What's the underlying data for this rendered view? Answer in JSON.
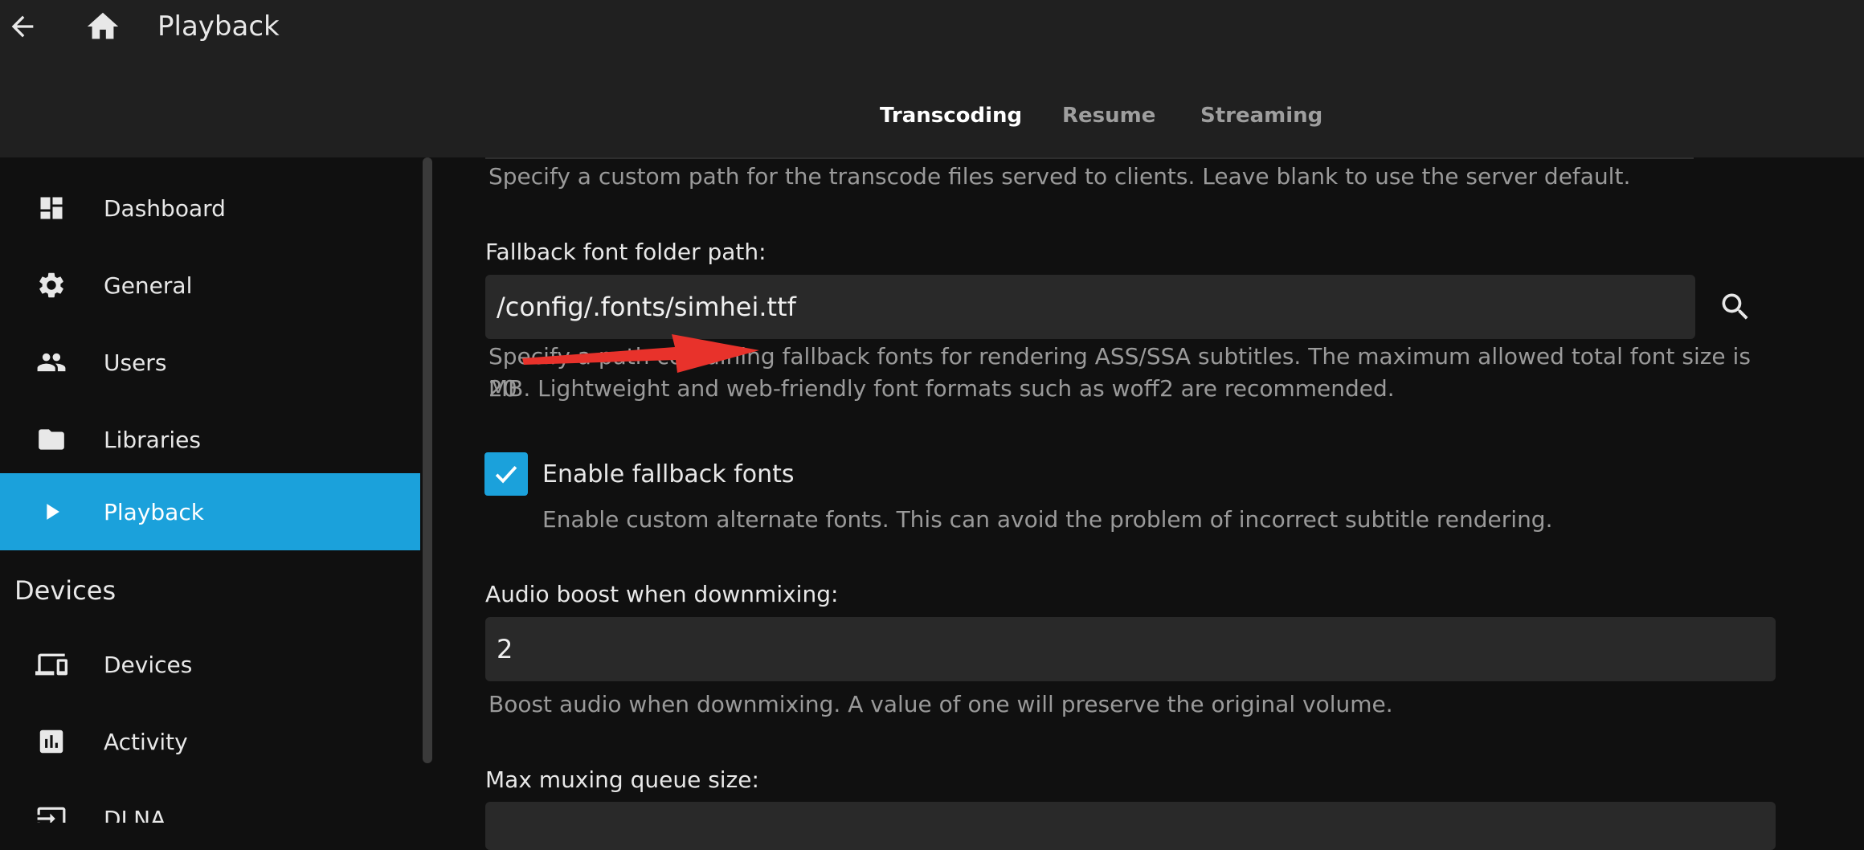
{
  "header": {
    "title": "Playback",
    "tabs": [
      {
        "label": "Transcoding",
        "active": true
      },
      {
        "label": "Resume",
        "active": false
      },
      {
        "label": "Streaming",
        "active": false
      }
    ]
  },
  "sidebar": {
    "items": [
      {
        "label": "Dashboard",
        "icon": "dashboard-icon"
      },
      {
        "label": "General",
        "icon": "gear-icon"
      },
      {
        "label": "Users",
        "icon": "people-icon"
      },
      {
        "label": "Libraries",
        "icon": "folder-icon"
      },
      {
        "label": "Playback",
        "icon": "play-icon",
        "active": true
      }
    ],
    "devices_section": {
      "title": "Devices",
      "items": [
        {
          "label": "Devices",
          "icon": "devices-icon"
        },
        {
          "label": "Activity",
          "icon": "activity-icon"
        },
        {
          "label": "DLNA",
          "icon": "input-icon"
        }
      ]
    }
  },
  "main": {
    "transcode_path_help": "Specify a custom path for the transcode files served to clients. Leave blank to use the server default.",
    "fallback_font": {
      "label": "Fallback font folder path:",
      "value": "/config/.fonts/simhei.ttf",
      "help_line1": "Specify a path containing fallback fonts for rendering ASS/SSA subtitles. The maximum allowed total font size is 20",
      "help_line2": "MB. Lightweight and web-friendly font formats such as woff2 are recommended."
    },
    "enable_fallback": {
      "label": "Enable fallback fonts",
      "checked": true,
      "help": "Enable custom alternate fonts. This can avoid the problem of incorrect subtitle rendering."
    },
    "audio_boost": {
      "label": "Audio boost when downmixing:",
      "value": "2",
      "help": "Boost audio when downmixing. A value of one will preserve the original volume."
    },
    "max_muxing": {
      "label": "Max muxing queue size:"
    }
  },
  "colors": {
    "accent": "#1ba1db",
    "header_bg": "#202020",
    "page_bg": "#101010",
    "input_bg": "#292929",
    "annotation_arrow": "#e8322b"
  }
}
